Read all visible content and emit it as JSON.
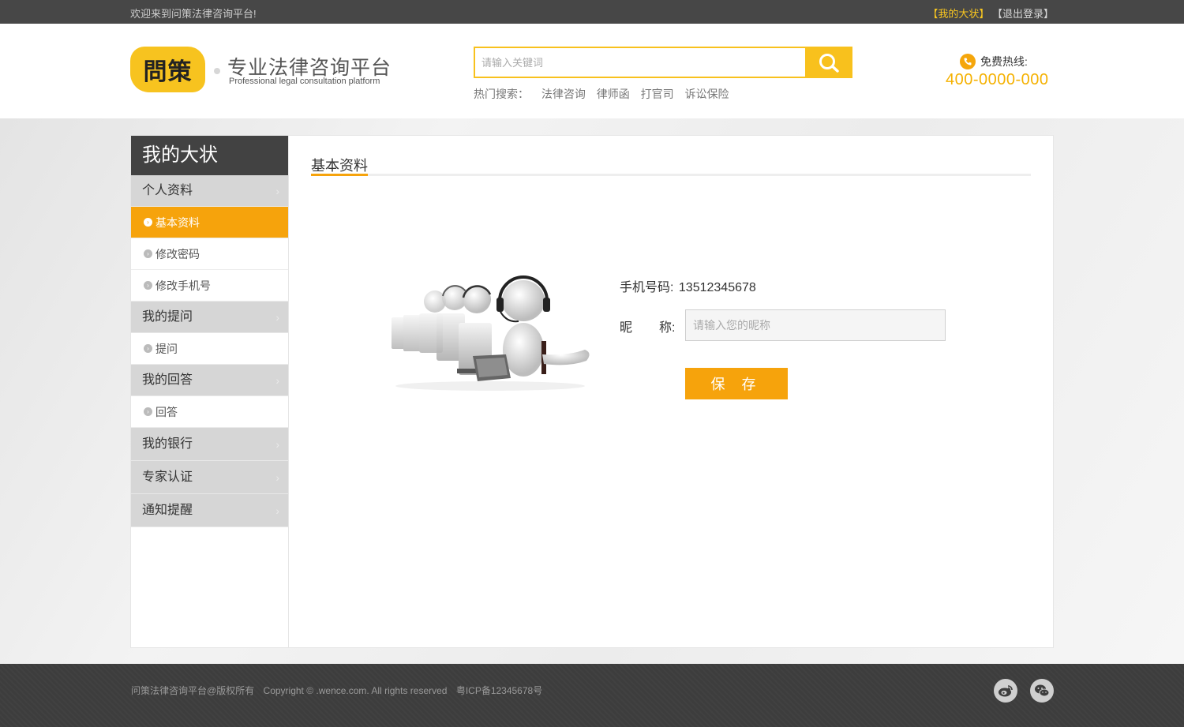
{
  "topbar": {
    "welcome": "欢迎来到问策法律咨询平台!",
    "my_link": "【我的大状】",
    "logout_link": "【退出登录】"
  },
  "header": {
    "logo_text": "問策",
    "slogan": "专业法律咨询平台",
    "slogan_en": "Professional legal consultation platform",
    "search_placeholder": "请输入关键词",
    "hot_label": "热门搜索：",
    "hot_links": [
      "法律咨询",
      "律师函",
      "打官司",
      "诉讼保险"
    ],
    "hotline_label": "免费热线:",
    "hotline_number": "400-0000-000"
  },
  "sidebar": {
    "title": "我的大状",
    "groups": [
      {
        "label": "个人资料",
        "items": [
          "基本资料",
          "修改密码",
          "修改手机号"
        ]
      },
      {
        "label": "我的提问",
        "items": [
          "提问"
        ]
      },
      {
        "label": "我的回答",
        "items": [
          "回答"
        ]
      },
      {
        "label": "我的银行",
        "items": []
      },
      {
        "label": "专家认证",
        "items": []
      },
      {
        "label": "通知提醒",
        "items": []
      }
    ],
    "active_item": "基本资料"
  },
  "main": {
    "title": "基本资料",
    "phone_label": "手机号码:",
    "phone_value": "13512345678",
    "nick_label_a": "昵",
    "nick_label_b": "称:",
    "nick_placeholder": "请输入您的昵称",
    "save_label": "保 存"
  },
  "footer": {
    "site": "问策法律咨询平台@版权所有",
    "copyright": "Copyright © .wence.com. All rights reserved",
    "icp": "粤ICP备12345678号"
  },
  "colors": {
    "accent": "#f6a30c",
    "brand_yellow": "#f8c11d",
    "topbar": "#474747",
    "footer": "#3d3d3d"
  }
}
